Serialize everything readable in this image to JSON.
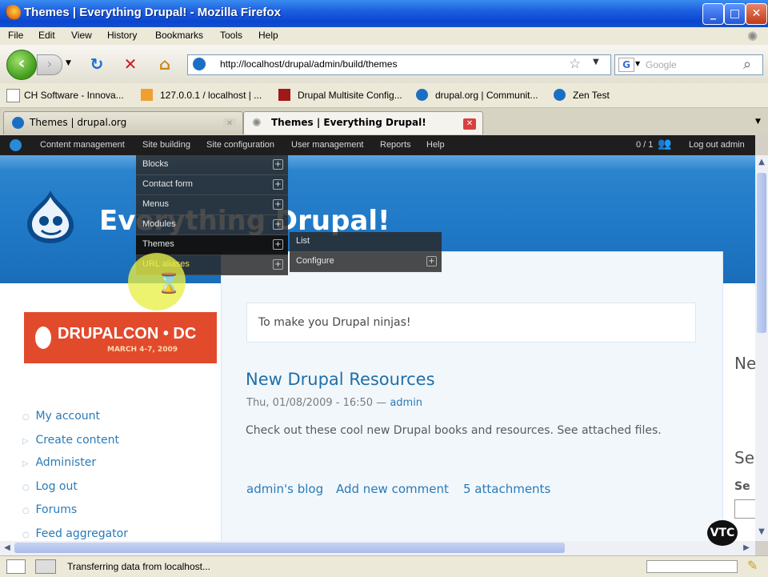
{
  "window": {
    "title": "Themes | Everything Drupal! - Mozilla Firefox",
    "minimize": "_",
    "maximize": "□",
    "close": "✕"
  },
  "menubar": [
    "File",
    "Edit",
    "View",
    "History",
    "Bookmarks",
    "Tools",
    "Help"
  ],
  "nav": {
    "url": "http://localhost/drupal/admin/build/themes",
    "search_engine_letter": "G",
    "search_placeholder": "Google"
  },
  "bookmarks": [
    "CH Software - Innova...",
    "127.0.0.1 / localhost | ...",
    "Drupal Multisite Config...",
    "drupal.org | Communit...",
    "Zen Test"
  ],
  "tabs": [
    {
      "label": "Themes | drupal.org",
      "active": false
    },
    {
      "label": "Themes | Everything Drupal!",
      "active": true
    }
  ],
  "admin_menu": {
    "items": [
      "Content management",
      "Site building",
      "Site configuration",
      "User management",
      "Reports",
      "Help"
    ],
    "user_count": "0 / 1",
    "logout": "Log out admin"
  },
  "site_building_menu": [
    {
      "label": "Blocks"
    },
    {
      "label": "Contact form"
    },
    {
      "label": "Menus"
    },
    {
      "label": "Modules"
    },
    {
      "label": "Themes",
      "active": true
    },
    {
      "label": "URL aliases",
      "highlight": true
    }
  ],
  "themes_submenu": [
    {
      "label": "List"
    },
    {
      "label": "Configure"
    }
  ],
  "site": {
    "name": "Everything Drupal!",
    "mission": "To make you Drupal ninjas!"
  },
  "banner": {
    "title": "DRUPALCON • DC",
    "date": "MARCH 4-7, 2009"
  },
  "sidebar_nav": [
    "My account",
    "Create content",
    "Administer",
    "Log out",
    "Forums",
    "Feed aggregator"
  ],
  "node": {
    "title": "New Drupal Resources",
    "date": "Thu, 01/08/2009 - 16:50 —",
    "author": "admin",
    "body": "Check out these cool new Drupal books and resources.  See attached files.",
    "links": [
      "admin's blog",
      "Add new comment",
      "5 attachments"
    ]
  },
  "right_column": {
    "cut1": "Ne",
    "cut2": "Se",
    "cut3": "Se"
  },
  "watermark": "VTC",
  "status": {
    "text": "Transferring data from localhost..."
  },
  "colors": {
    "accent": "#2a7ab8",
    "header_blue": "#1f78c6",
    "admin_bar": "#1e1e1e",
    "banner": "#e24a2c"
  }
}
